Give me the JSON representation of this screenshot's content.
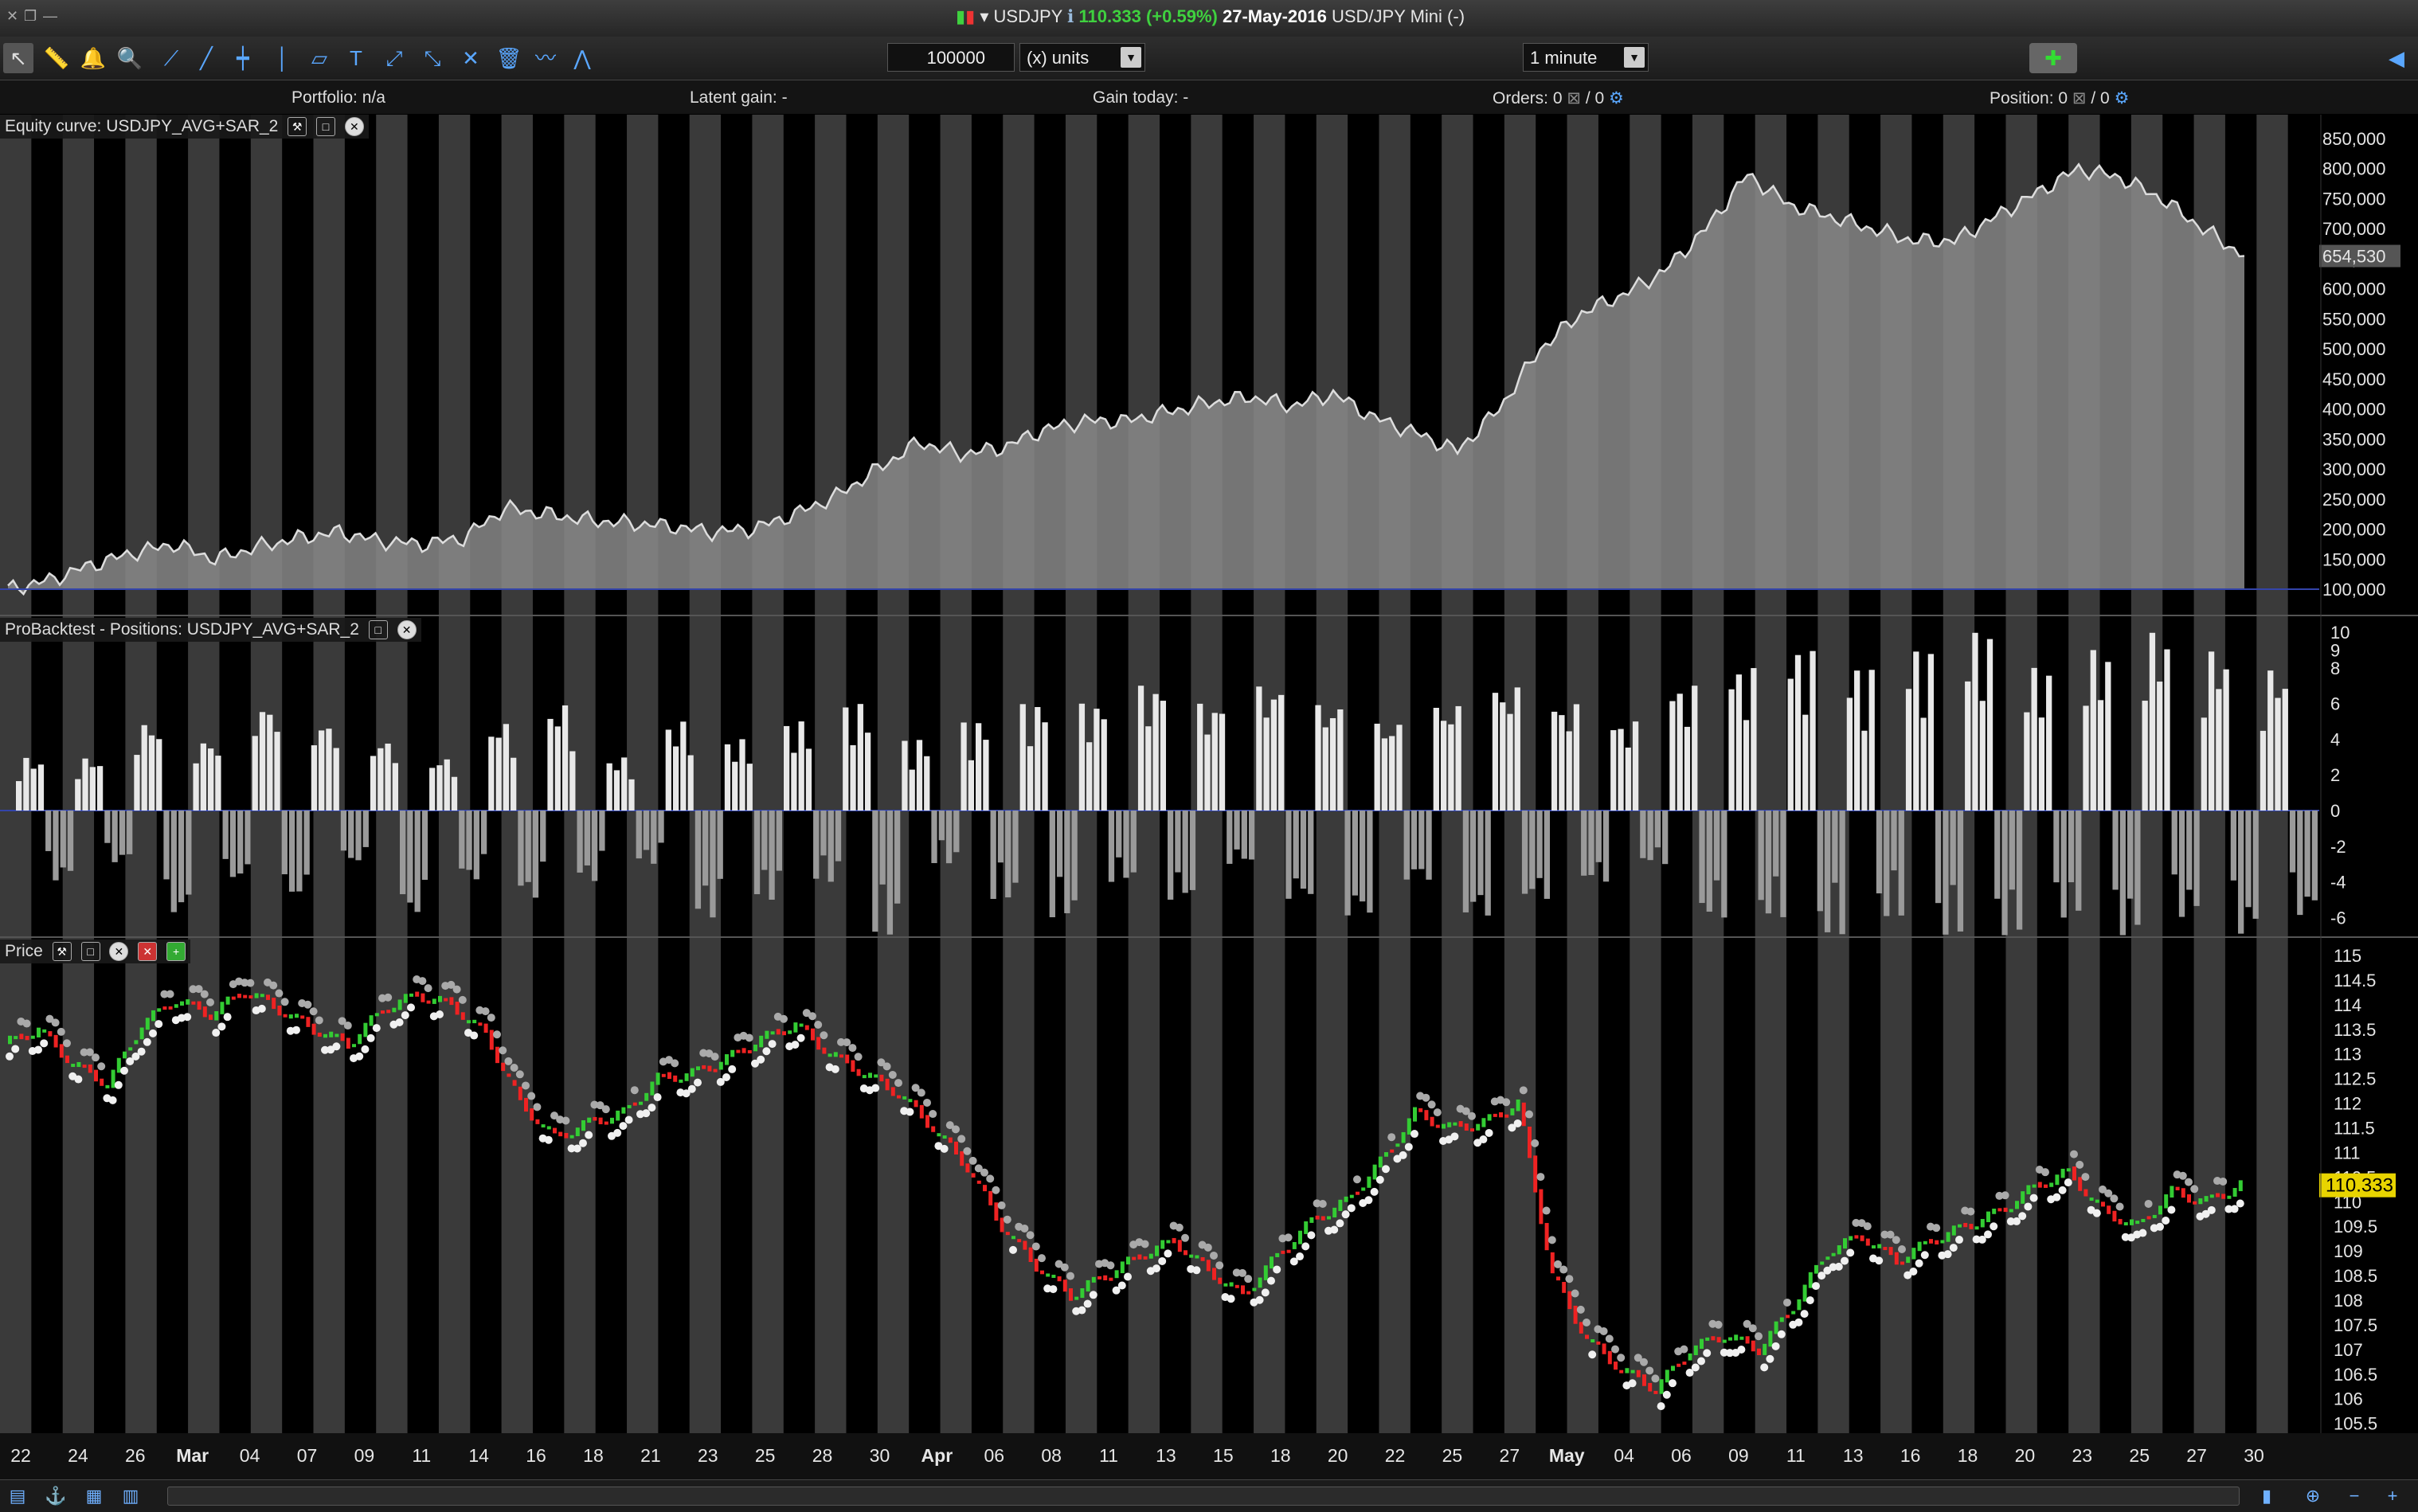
{
  "window": {
    "symbol": "USDJPY",
    "price": "110.333 (+0.59%)",
    "date": "27-May-2016",
    "instrument": "USD/JPY Mini (-)"
  },
  "toolbar": {
    "quantity": "100000",
    "units": "(x) units",
    "timeframe": "1 minute"
  },
  "info": {
    "portfolio_label": "Portfolio:",
    "portfolio_value": "n/a",
    "latent_label": "Latent gain:",
    "latent_value": "-",
    "gain_today_label": "Gain today:",
    "gain_today_value": "-",
    "orders_label": "Orders:",
    "orders_value_a": "0",
    "orders_value_b": "/ 0",
    "position_label": "Position:",
    "position_value_a": "0",
    "position_value_b": "/ 0"
  },
  "panels": {
    "equity_title": "Equity curve: USDJPY_AVG+SAR_2",
    "positions_title": "ProBacktest - Positions: USDJPY_AVG+SAR_2",
    "price_title": "Price"
  },
  "colors": {
    "background": "#000000",
    "stripe": "#3a3a3a",
    "equity_fill": "#8a8a8a",
    "equity_line": "#dddddd",
    "baseline": "#3344aa",
    "long_bar": "#e8e8e8",
    "short_bar": "#9a9a9a",
    "up_candle": "#33cc33",
    "down_candle": "#ee2222",
    "sar_dot": "#f0f0f0",
    "last_price_bg": "#e8d400"
  },
  "chart_data": [
    {
      "type": "area",
      "title": "Equity curve: USDJPY_AVG+SAR_2",
      "x_labels": [
        "22",
        "24",
        "26",
        "Mar",
        "04",
        "07",
        "09",
        "11",
        "14",
        "16",
        "18",
        "21",
        "23",
        "25",
        "28",
        "30",
        "Apr",
        "06",
        "08",
        "11",
        "13",
        "15",
        "18",
        "20",
        "22",
        "25",
        "27",
        "May",
        "04",
        "06",
        "09",
        "11",
        "13",
        "16",
        "18",
        "20",
        "23",
        "25",
        "27",
        "30"
      ],
      "y": [
        100000,
        115000,
        140000,
        160000,
        175000,
        150000,
        170000,
        185000,
        195000,
        180000,
        175000,
        185000,
        235000,
        225000,
        215000,
        210000,
        205000,
        195000,
        200000,
        225000,
        255000,
        300000,
        345000,
        325000,
        335000,
        365000,
        380000,
        380000,
        395000,
        410000,
        420000,
        405000,
        425000,
        385000,
        360000,
        330000,
        400000,
        500000,
        560000,
        590000,
        630000,
        700000,
        790000,
        740000,
        720000,
        700000,
        680000,
        680000,
        720000,
        760000,
        800000,
        785000,
        750000,
        700000,
        654530
      ],
      "last_value": "654,530",
      "y_ticks": [
        "850,000",
        "800,000",
        "750,000",
        "700,000",
        "650,000",
        "600,000",
        "550,000",
        "500,000",
        "450,000",
        "400,000",
        "350,000",
        "300,000",
        "250,000",
        "200,000",
        "150,000",
        "100,000"
      ],
      "ylim": [
        100000,
        850000
      ],
      "grid": false
    },
    {
      "type": "bar",
      "title": "ProBacktest - Positions: USDJPY_AVG+SAR_2",
      "y_ticks": [
        "10",
        "9",
        "8",
        "6",
        "4",
        "2",
        "0",
        "-2",
        "-4",
        "-6"
      ],
      "ylim": [
        -7,
        10
      ],
      "values": [
        3,
        -4,
        3,
        -3,
        5,
        -6,
        4,
        -4,
        6,
        -5,
        5,
        -3,
        4,
        -6,
        3,
        -4,
        5,
        -5,
        6,
        -4,
        3,
        -3,
        5,
        -6,
        4,
        -5,
        5,
        -4,
        6,
        -7,
        4,
        -3,
        5,
        -5,
        6,
        -6,
        6,
        -4,
        7,
        -5,
        6,
        -3,
        7,
        -5,
        6,
        -6,
        5,
        -4,
        6,
        -6,
        7,
        -5,
        6,
        -4,
        5,
        -3,
        7,
        -6,
        8,
        -6,
        9,
        -7,
        8,
        -6,
        9,
        -7,
        10,
        -7,
        8,
        -6,
        9,
        -7,
        10,
        -6,
        9,
        -7,
        8,
        -6
      ]
    },
    {
      "type": "line",
      "title": "Price",
      "y_ticks": [
        "115",
        "114.5",
        "114",
        "113.5",
        "113",
        "112.5",
        "112",
        "111.5",
        "111",
        "110.5",
        "110",
        "109.5",
        "109",
        "108.5",
        "108",
        "107.5",
        "107",
        "106.5",
        "106",
        "105.5"
      ],
      "ylim": [
        105.3,
        115
      ],
      "last_price": "110.333",
      "close": [
        113.2,
        113.5,
        112.8,
        112.4,
        113.6,
        114.1,
        113.8,
        114.3,
        113.9,
        113.5,
        113.2,
        113.9,
        114.2,
        114.0,
        113.4,
        112.0,
        111.3,
        111.6,
        111.8,
        112.5,
        112.6,
        112.9,
        113.3,
        113.6,
        113.0,
        112.6,
        112.2,
        111.5,
        110.7,
        109.5,
        108.7,
        108.1,
        108.5,
        108.9,
        109.2,
        108.6,
        108.1,
        108.9,
        109.6,
        110.0,
        110.8,
        111.8,
        111.5,
        111.6,
        112.0,
        108.5,
        107.2,
        106.6,
        106.2,
        107.0,
        107.3,
        107.0,
        107.9,
        109.0,
        109.3,
        108.8,
        109.2,
        109.5,
        109.8,
        110.3,
        110.6,
        109.8,
        109.5,
        110.2,
        110.0,
        110.333
      ]
    }
  ],
  "axes": {
    "date_labels": [
      "22",
      "24",
      "26",
      "Mar",
      "04",
      "07",
      "09",
      "11",
      "14",
      "16",
      "18",
      "21",
      "23",
      "25",
      "28",
      "30",
      "Apr",
      "06",
      "08",
      "11",
      "13",
      "15",
      "18",
      "20",
      "22",
      "25",
      "27",
      "May",
      "04",
      "06",
      "09",
      "11",
      "13",
      "16",
      "18",
      "20",
      "23",
      "25",
      "27",
      "30"
    ]
  }
}
